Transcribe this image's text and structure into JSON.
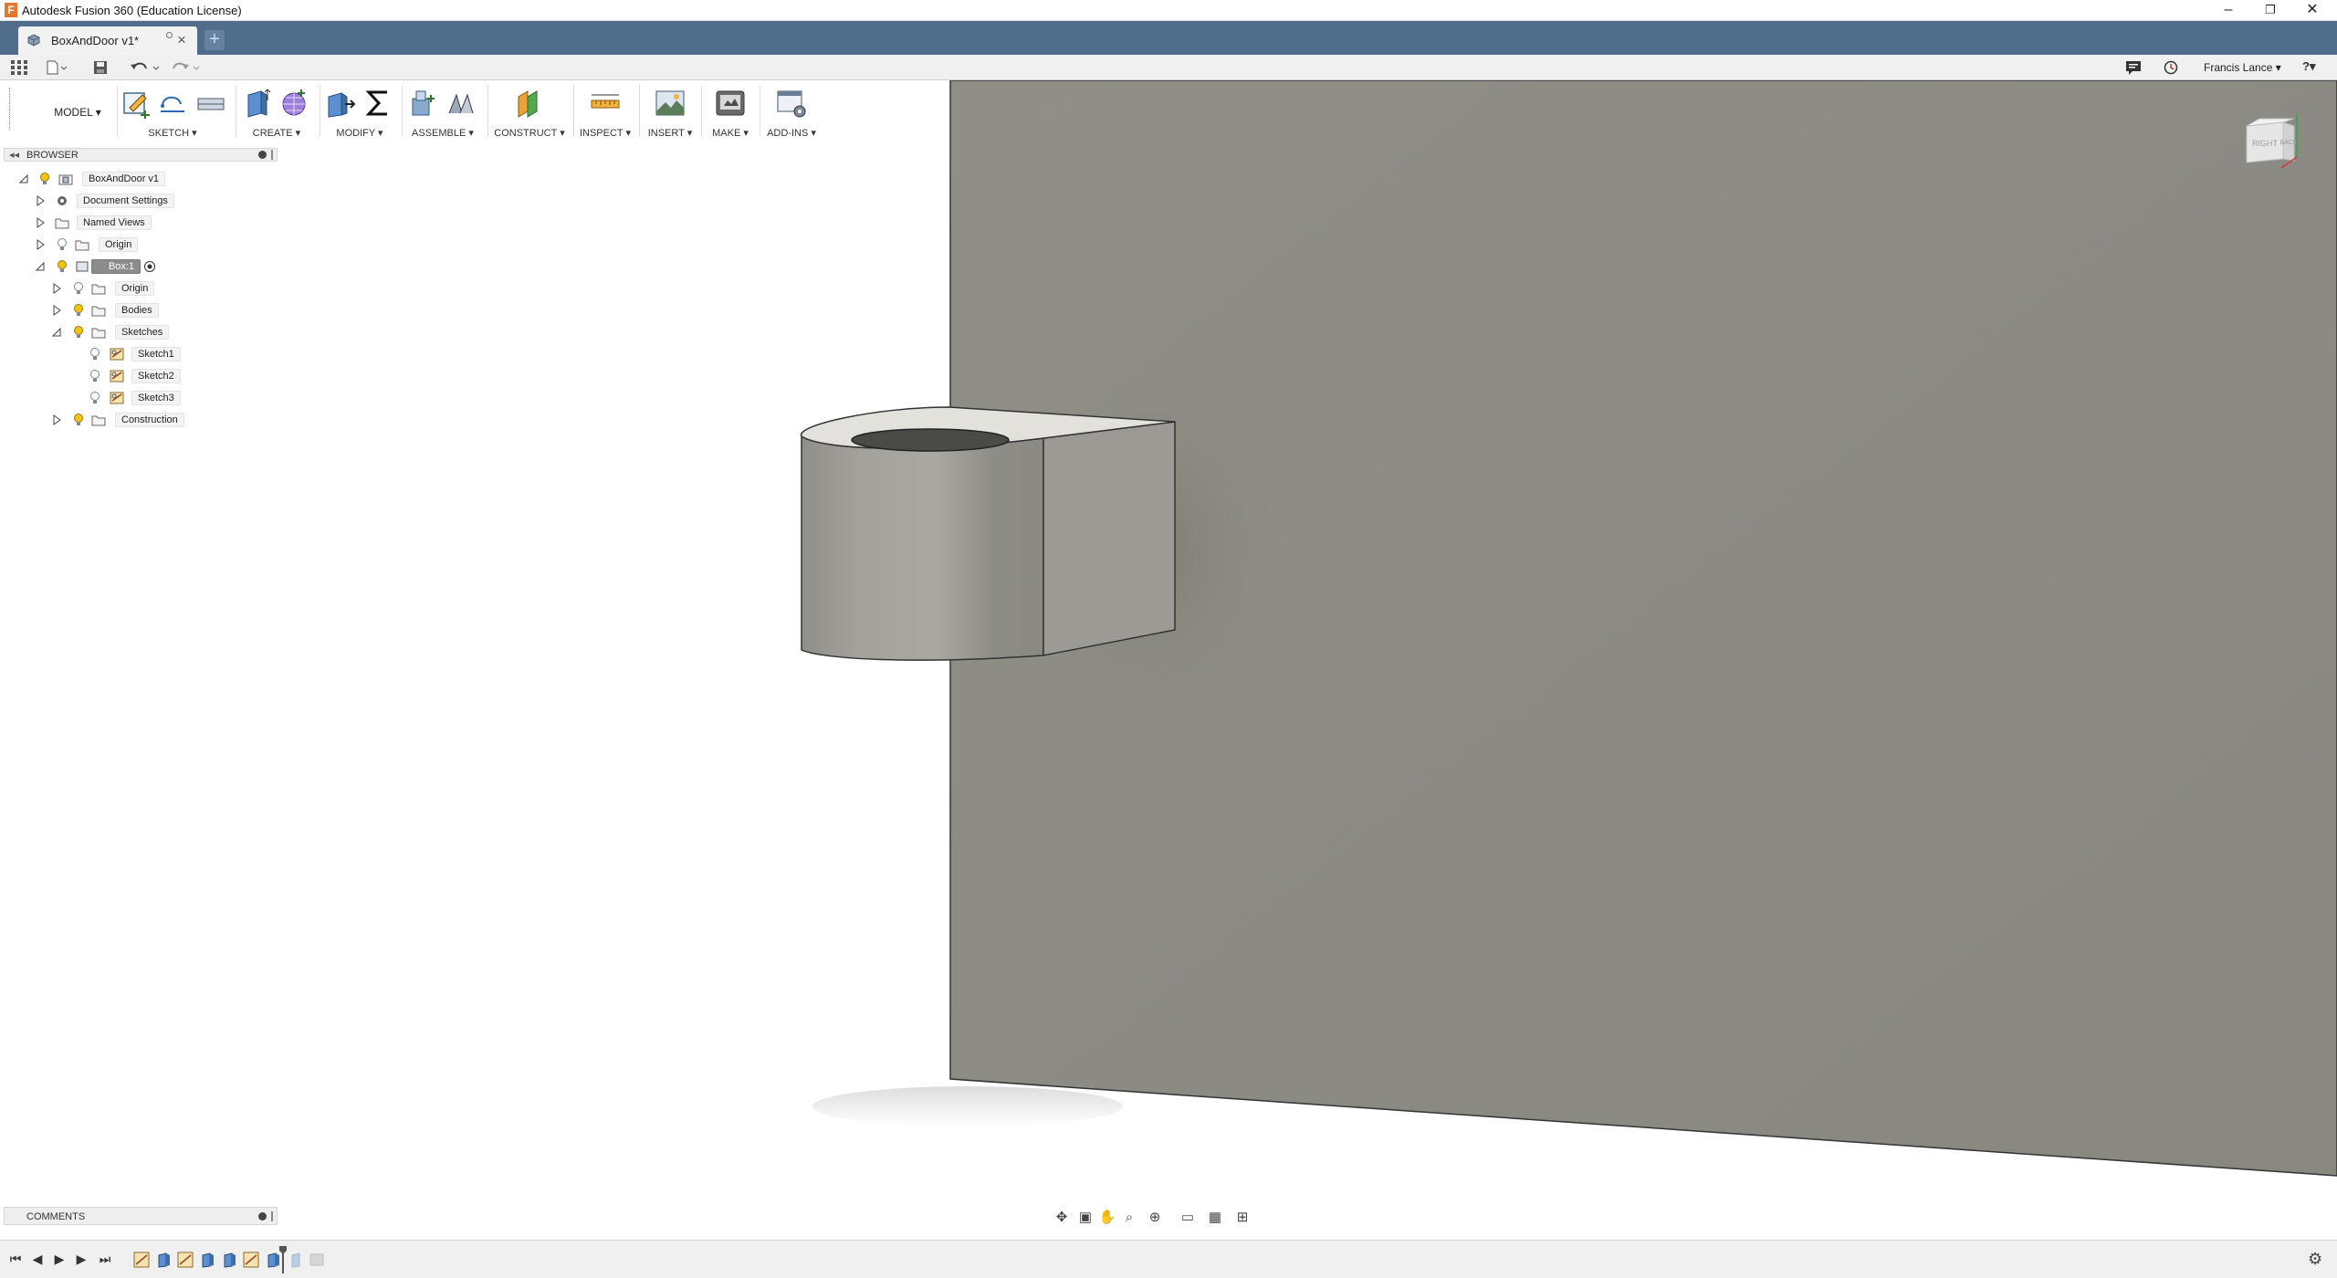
{
  "window": {
    "title": "Autodesk Fusion 360 (Education License)",
    "app_icon": "F",
    "minimize": "–",
    "restore": "❐",
    "close": "✕"
  },
  "tabs": {
    "active_label": "BoxAndDoor v1*",
    "close_glyph": "×",
    "new_tab_glyph": "+"
  },
  "quick_access": {
    "user_name": "Francis Lance ▾",
    "help": "?▾"
  },
  "toolbar": {
    "workspace": "MODEL ▾",
    "groups": [
      "SKETCH ▾",
      "CREATE ▾",
      "MODIFY ▾",
      "ASSEMBLE ▾",
      "CONSTRUCT ▾",
      "INSPECT ▾",
      "INSERT ▾",
      "MAKE ▾",
      "ADD-INS ▾"
    ]
  },
  "browser": {
    "title": "BROWSER",
    "items": [
      {
        "label": "BoxAndDoor v1"
      },
      {
        "label": "Document Settings"
      },
      {
        "label": "Named Views"
      },
      {
        "label": "Origin"
      },
      {
        "label": "Box:1"
      },
      {
        "label": "Origin"
      },
      {
        "label": "Bodies"
      },
      {
        "label": "Sketches"
      },
      {
        "label": "Sketch1"
      },
      {
        "label": "Sketch2"
      },
      {
        "label": "Sketch3"
      },
      {
        "label": "Construction"
      }
    ]
  },
  "viewcube": {
    "face_right": "RIGHT",
    "face_back": "BACK"
  },
  "comments": {
    "title": "COMMENTS"
  },
  "colors": {
    "tabbar": "#506d8c",
    "wall": "#8d8c85",
    "part": "#9a9994",
    "bulb": "#f1c40f",
    "selected_item": "#8c8c8c"
  }
}
